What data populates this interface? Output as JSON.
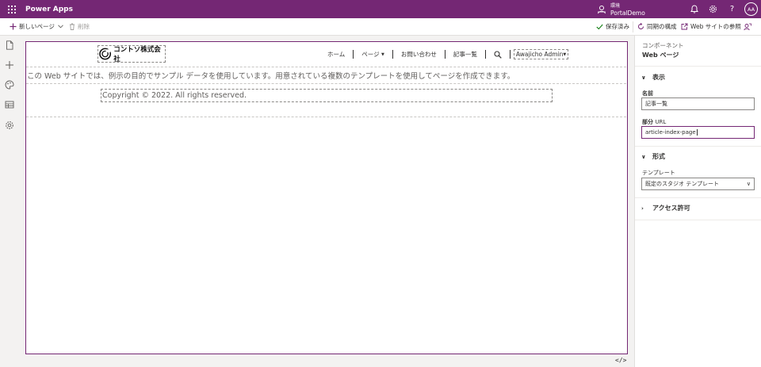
{
  "app": {
    "title": "Power Apps"
  },
  "environment": {
    "label": "環境",
    "name": "PortalDemo"
  },
  "user": {
    "initials": "AA"
  },
  "commands": {
    "new_page": "新しいページ",
    "delete": "削除",
    "saved": "保存済み",
    "sync": "同期の構成",
    "browse": "Web サイトの参照"
  },
  "site": {
    "logo_text": "コントソ株式会社",
    "nav": [
      "ホーム",
      "ページ",
      "お問い合わせ",
      "記事一覧"
    ],
    "user_menu": "Awajicho Admin",
    "intro": "この Web サイトでは、例示の目的でサンプル データを使用しています。用意されている複数のテンプレートを使用してページを作成できます。",
    "copyright": "Copyright © 2022. All rights reserved."
  },
  "code_toggle": "</>",
  "pane": {
    "subtitle": "コンポーネント",
    "title": "Web ページ",
    "sections": {
      "display": "表示",
      "format": "形式",
      "access": "アクセス許可"
    },
    "name_label": "名前",
    "name_value": "記事一覧",
    "url_label_bold": "部分",
    "url_label_light": "URL",
    "url_value": "article-index-page",
    "template_label": "テンプレート",
    "template_value": "既定のスタジオ テンプレート"
  },
  "colors": {
    "brand": "#742774",
    "canvas_border": "#742774"
  }
}
